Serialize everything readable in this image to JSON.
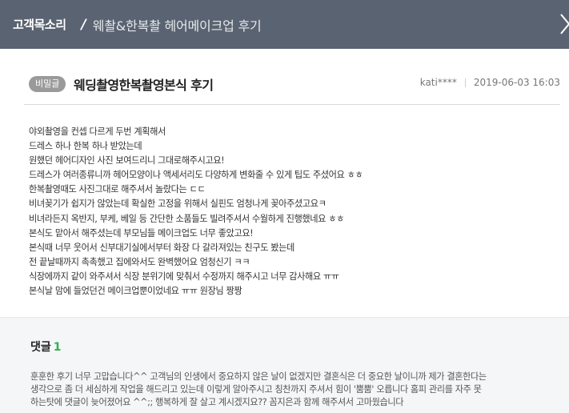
{
  "header": {
    "brand": "고객목소리",
    "separator": "/",
    "breadcrumb": "웨촬&한복촬 헤어메이크업 후기"
  },
  "post": {
    "badge": "비밀글",
    "title": "웨딩촬영한복촬영본식 후기",
    "author": "kati****",
    "datetime": "2019-06-03 16:03",
    "body_lines": [
      "야외촬영을 컨셉 다르게 두번 계획해서",
      "드레스 하나 한복 하나 받았는데",
      "원했던 헤어디자인 사진 보여드리니 그대로해주시고요!",
      "드레스가 여러종류니까 헤어모양이나 액세서리도 다양하게 변화줄 수 있게 팁도 주셨어요 ㅎㅎ",
      "한복촬영때도 사진그대로 해주셔서 놀랐다는 ㄷㄷ",
      "비녀꽂기가 쉽지가 않았는데 확실한 고정을 위해서 실핀도 엄청나게 꽂아주셨고요ㅋ",
      "비녀라든지 옥반지, 부케, 베일 등 간단한 소품들도 빌려주셔서 수월하게 진행했네요 ㅎㅎ",
      "본식도 맡아서 해주셨는데 부모님들 메이크업도 너무 좋았고요!",
      "본식때 너무 웃어서 신부대기실에서부터 화장 다 갈라져있는 친구도 봤는데",
      "전 끝날때까지 촉촉했고 집에와서도 완벽했어요 엄청신기 ㅋㅋ",
      "식장에까지 같이 와주셔서 식장 분위기에 맞춰서 수정까지 해주시고 너무 감사해요 ㅠㅠ",
      "본식날 맘에 들었던건 메이크업뿐이었네요 ㅠㅠ 원장님 짱짱"
    ]
  },
  "comments": {
    "label": "댓글",
    "count": "1",
    "reply_lines": [
      "훈훈한 후기 너무 고맙습니다^^ 고객님의 인생에서 중요하지 않은 날이 없겠지만 결혼식은 더 중요한 날이니까 제가 결혼한다는",
      "생각으로 좀 더 세심하게 작업을 해드리고 있는데 이렇게 알아주시고 칭찬까지 주셔서 힘이 '뿜뿜' 오릅니다 홈피 관리를 자주 못",
      "하는탓에 댓글이 늦어졌어요 ^^;; 행복하게 잘 살고 계시겠지요?? 꼼지은과 함께 해주셔서 고마웠습니다"
    ]
  },
  "icons": {
    "next": "chevron-right-icon"
  },
  "colors": {
    "header_bg": "#5a6371",
    "badge_bg": "#9a9a9a",
    "comment_count": "#31b04e",
    "comments_bg": "#f5f6f7"
  }
}
